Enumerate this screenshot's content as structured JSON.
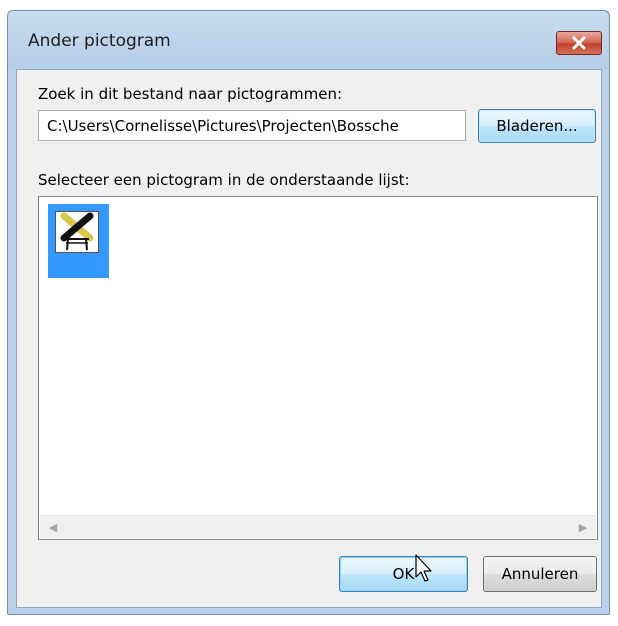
{
  "window": {
    "title": "Ander pictogram",
    "close_icon": "close-x-icon"
  },
  "file_section": {
    "label": "Zoek in dit bestand naar pictogrammen:",
    "path_value": "C:\\Users\\Cornelisse\\Pictures\\Projecten\\Bossche",
    "browse_label": "Bladeren..."
  },
  "icon_list": {
    "label": "Selecteer een pictogram in de onderstaande lijst:",
    "items": [
      {
        "icon": "crossed-tools-scaffold-icon",
        "selected": true
      }
    ]
  },
  "footer": {
    "ok_label": "OK",
    "cancel_label": "Annuleren"
  },
  "colors": {
    "selection": "#3399ff",
    "close_button": "#c4412c",
    "frame": "#b9d1ea"
  }
}
